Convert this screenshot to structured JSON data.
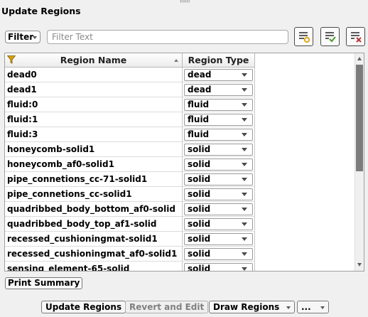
{
  "panel": {
    "title": "Update Regions"
  },
  "filter": {
    "mode_label": "Filter",
    "placeholder": "Filter Text",
    "value": ""
  },
  "table": {
    "columns": [
      "Region Name",
      "Region Type"
    ],
    "rows": [
      {
        "name": "dead0",
        "type": "dead"
      },
      {
        "name": "dead1",
        "type": "dead"
      },
      {
        "name": "fluid:0",
        "type": "fluid"
      },
      {
        "name": "fluid:1",
        "type": "fluid"
      },
      {
        "name": "fluid:3",
        "type": "fluid"
      },
      {
        "name": "honeycomb-solid1",
        "type": "solid"
      },
      {
        "name": "honeycomb_af0-solid1",
        "type": "solid"
      },
      {
        "name": "pipe_connetions_cc-71-solid1",
        "type": "solid"
      },
      {
        "name": "pipe_connetions_cc-solid1",
        "type": "solid"
      },
      {
        "name": "quadribbed_body_bottom_af0-solid",
        "type": "solid"
      },
      {
        "name": "quadribbed_body_top_af1-solid",
        "type": "solid"
      },
      {
        "name": "recessed_cushioningmat-solid1",
        "type": "solid"
      },
      {
        "name": "recessed_cushioningmat_af0-solid1",
        "type": "solid"
      },
      {
        "name": "sensing_element-65-solid",
        "type": "solid"
      }
    ]
  },
  "actions": {
    "print_summary": "Print Summary",
    "update_regions": "Update Regions",
    "revert_and_edit": "Revert and Edit",
    "draw_regions": "Draw Regions",
    "more": "..."
  },
  "colors": {
    "border": "#a0a0a0",
    "scroll_thumb": "#7c7c7c",
    "icon_yellow": "#e0a000",
    "icon_green": "#4a9a2a",
    "icon_red": "#c03030"
  }
}
